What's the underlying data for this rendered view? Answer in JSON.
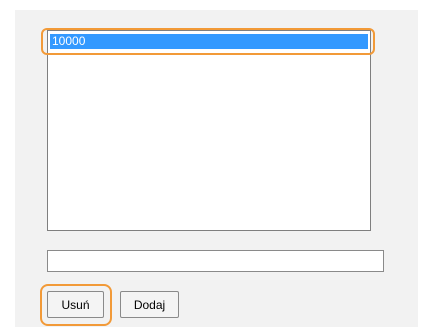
{
  "list": {
    "items": [
      {
        "label": "10000",
        "selected": true
      }
    ]
  },
  "input": {
    "value": "",
    "placeholder": ""
  },
  "buttons": {
    "remove_label": "Usuń",
    "add_label": "Dodaj"
  },
  "colors": {
    "selection": "#3399ff",
    "highlight_outline": "#f29a38",
    "panel_background": "#f2f2f2"
  }
}
